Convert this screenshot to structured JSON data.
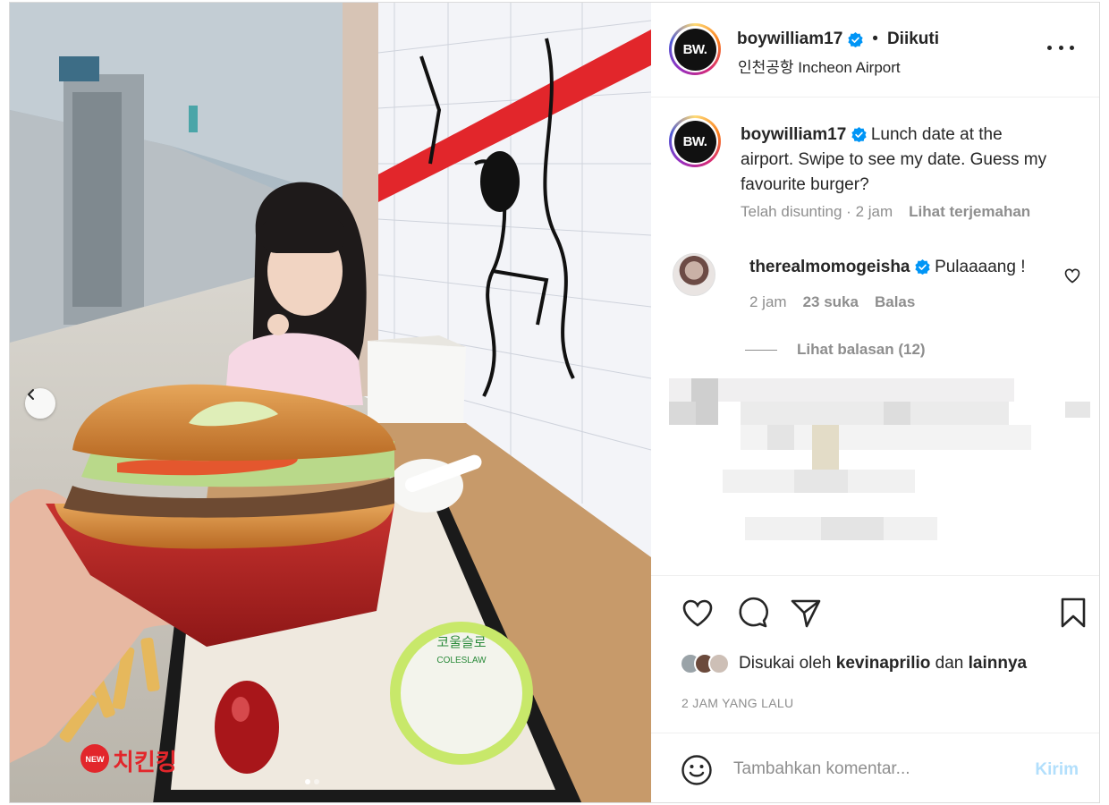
{
  "post": {
    "username": "boywilliam17",
    "separator": "•",
    "follow_status": "Diikuti",
    "location": "인천공항 Incheon Airport",
    "avatar_text": "BW."
  },
  "caption": {
    "username": "boywilliam17",
    "text": "Lunch date at the airport. Swipe to see my date. Guess my favourite burger?",
    "edited": "Telah disunting",
    "separator": "·",
    "time": "2 jam",
    "translate": "Lihat terjemahan"
  },
  "comment": {
    "username": "therealmomogeisha",
    "text": "Pulaaaang !",
    "time": "2 jam",
    "likes": "23 suka",
    "reply": "Balas",
    "view_replies": "Lihat balasan (12)"
  },
  "likes": {
    "prefix": "Disukai oleh",
    "user": "kevinaprilio",
    "conjunction": "dan",
    "others": "lainnya"
  },
  "time_ago": "2 JAM YANG LALU",
  "add_comment": {
    "placeholder": "Tambahkan komentar...",
    "send_label": "Kirim"
  },
  "photo": {
    "coleslaw_korean": "코울슬로",
    "coleslaw_label": "COLESLAW",
    "wrapper_text": "치킨킹",
    "new_badge": "NEW",
    "dots_count": 2
  },
  "icons": [
    "verified-icon",
    "more-icon",
    "heart-icon",
    "comment-icon",
    "share-icon",
    "bookmark-icon",
    "emoji-icon",
    "chevron-left-icon"
  ],
  "colors": {
    "verified": "#0095f6",
    "send_disabled": "#b2dffc",
    "meta_gray": "#8e8e8e",
    "text": "#262626",
    "accent_red": "#e2262b"
  }
}
